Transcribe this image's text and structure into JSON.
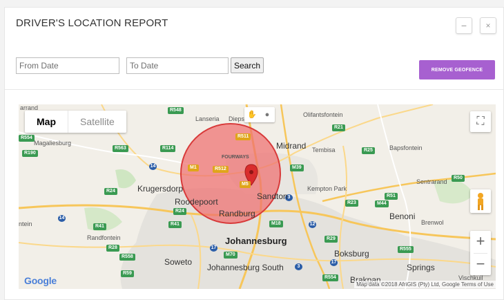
{
  "panel": {
    "title": "DRIVER'S LOCATION REPORT",
    "minimize_label": "−",
    "close_label": "×"
  },
  "filters": {
    "from_placeholder": "From Date",
    "to_placeholder": "To Date",
    "search_label": "Search",
    "remove_geofence_label": "REMOVE GEOFENCE"
  },
  "map": {
    "type_control": {
      "map_label": "Map",
      "satellite_label": "Satellite"
    },
    "fullscreen_glyph": "⛶",
    "zoom_in": "+",
    "zoom_out": "−",
    "draw_hand_glyph": "✋",
    "draw_circle_glyph": "●",
    "google_logo": "Google",
    "attribution": "Map data ©2018 AfriGIS (Pty) Ltd, Google   Terms of Use",
    "geofence_color": "#e84a4a",
    "places_big": [
      "Midrand",
      "Johannesburg",
      "Benoni",
      "Boksburg",
      "Springs",
      "Krugersdorp",
      "Roodepoort",
      "Sandton",
      "Randburg",
      "Soweto",
      "Johannesburg South",
      "Brakpan"
    ],
    "places": {
      "arrand": "arrand",
      "magaliesburg": "Magaliesburg",
      "lanseria": "Lanseria",
      "diepsloot": "Diepsl",
      "olifantsfontein": "Olifantsfontein",
      "tembisa": "Tembisa",
      "bapsfontein": "Bapsfontein",
      "fourways": "FOURWAYS",
      "kempton": "Kempton Park",
      "sentrarand": "Sentrarand",
      "randfontein": "Randfontein",
      "brenwol": "Brenwol",
      "ntein": "ntein",
      "vischkuil": "Vischkuil",
      "krugersdorp": "Krugersdorp",
      "roodepoort": "Roodepoort",
      "randburg": "Randburg",
      "sandton": "Sandton",
      "midrand": "Midrand",
      "johannesburg": "Johannesburg",
      "benoni": "Benoni",
      "boksburg": "Boksburg",
      "soweto": "Soweto",
      "jhb_south": "Johannesburg South",
      "springs": "Springs",
      "brakpan": "Brakpan"
    },
    "shields": {
      "r548": "R548",
      "r554": "R554",
      "r114": "R114",
      "r563": "R563",
      "r190": "R190",
      "r511": "R511",
      "m1": "M1",
      "r512": "R512",
      "m39": "M39",
      "r25": "R25",
      "r21": "R21",
      "r50": "R50",
      "r24": "R24",
      "m5": "M5",
      "r23": "R23",
      "r51": "R51",
      "m44": "M44",
      "r41": "R41",
      "r28": "R28",
      "r558": "R558",
      "m70": "M70",
      "r29": "R29",
      "r555": "R555",
      "n14": "14",
      "n3": "3",
      "n12": "12",
      "n17": "17",
      "m18": "M18",
      "r59": "R59",
      "r554b": "R554"
    }
  }
}
